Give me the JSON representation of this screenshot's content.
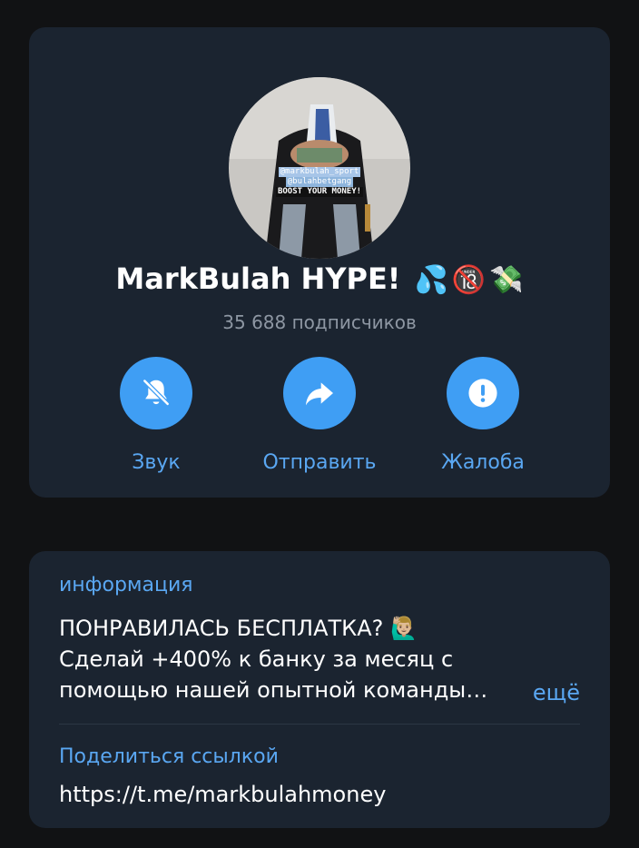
{
  "channel": {
    "name": "MarkBulah HYPE!",
    "emojis": [
      "💦",
      "🔞",
      "💸"
    ],
    "subscribers": "35 688 подписчиков",
    "avatar_caption": [
      "@markbulah_sport",
      "@bulahbetgang",
      "BOOST YOUR MONEY!"
    ]
  },
  "actions": [
    {
      "label": "Звук",
      "icon": "bell-muted-icon"
    },
    {
      "label": "Отправить",
      "icon": "share-arrow-icon"
    },
    {
      "label": "Жалоба",
      "icon": "exclamation-icon"
    }
  ],
  "info": {
    "label": "информация",
    "lines": [
      "ПОНРАВИЛАСЬ БЕСПЛАТКА? 🙋🏼‍♂️",
      "Сделай +400% к банку за месяц с",
      "помощью нашей опытной команды…"
    ],
    "more": "ещё"
  },
  "share": {
    "label": "Поделиться ссылкой",
    "url": "https://t.me/markbulahmoney"
  },
  "colors": {
    "background": "#111214",
    "card": "#1b2430",
    "accent": "#3f9ef4",
    "link": "#5aa7f2",
    "secondary_text": "#8e97a3"
  }
}
